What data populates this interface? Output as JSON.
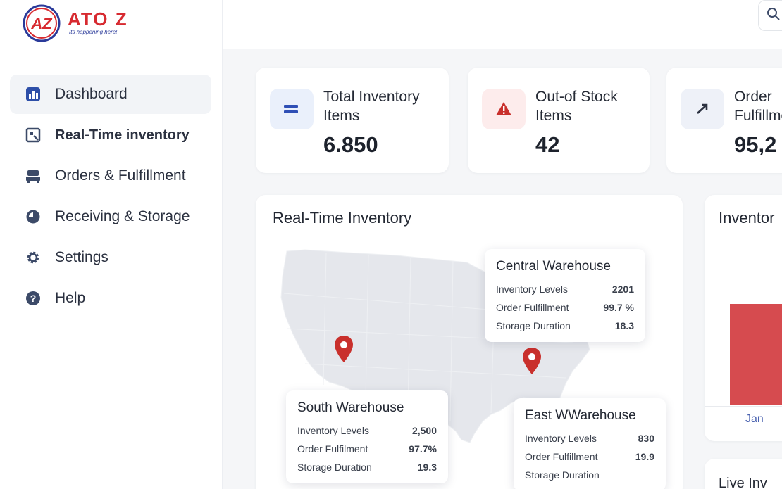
{
  "brand": {
    "name": "ATO Z",
    "tagline": "Its happening here!",
    "mark": "AZ",
    "color": "#d72a30"
  },
  "sidebar": {
    "items": [
      {
        "label": "Dashboard",
        "icon": "bar-chart-icon",
        "active": true
      },
      {
        "label": "Real-Time inventory",
        "icon": "inventory-icon",
        "active": false
      },
      {
        "label": "Orders & Fulfillment",
        "icon": "truck-icon",
        "active": false
      },
      {
        "label": "Receiving & Storage",
        "icon": "storage-icon",
        "active": false
      },
      {
        "label": "Settings",
        "icon": "gear-icon",
        "active": false
      },
      {
        "label": "Help",
        "icon": "help-icon",
        "active": false
      }
    ]
  },
  "topbar": {
    "search_icon": "search-icon"
  },
  "stats": [
    {
      "title": "Total Inventory Items",
      "value": "6.850",
      "icon": "equals-icon",
      "icon_bg": "#eaf0fb",
      "icon_color": "#2f4fb5"
    },
    {
      "title": "Out-of Stock Items",
      "value": "42",
      "icon": "warning-icon",
      "icon_bg": "#fdecec",
      "icon_color": "#c9302c"
    },
    {
      "title": "Order Fulfillment",
      "value": "95,2",
      "icon": "trend-up-icon",
      "icon_bg": "#eef1f8",
      "icon_color": "#2b3140"
    }
  ],
  "map": {
    "title": "Real-Time Inventory",
    "warehouses": [
      {
        "name": "Central Warehouse",
        "rows": [
          {
            "label": "Inventory Levels",
            "value": "2201"
          },
          {
            "label": "Order Fulfillment",
            "value": "99.7 %"
          },
          {
            "label": "Storage Duration",
            "value": "18.3"
          }
        ]
      },
      {
        "name": "South Warehouse",
        "rows": [
          {
            "label": "Inventory Levels",
            "value": "2,500"
          },
          {
            "label": "Order Fulfilment",
            "value": "97.7%"
          },
          {
            "label": "Storage Duration",
            "value": "19.3"
          }
        ]
      },
      {
        "name": "East WWarehouse",
        "rows": [
          {
            "label": "Inventory Levels",
            "value": "830"
          },
          {
            "label": "Order Fulfillment",
            "value": "19.9"
          },
          {
            "label": "Storage Duration",
            "value": ""
          }
        ]
      }
    ],
    "pin_color": "#c9302c"
  },
  "inventory_chart": {
    "title": "Inventor",
    "month": "Jan",
    "bar_color": "#d64b4f"
  },
  "live": {
    "title": "Live Inv"
  }
}
